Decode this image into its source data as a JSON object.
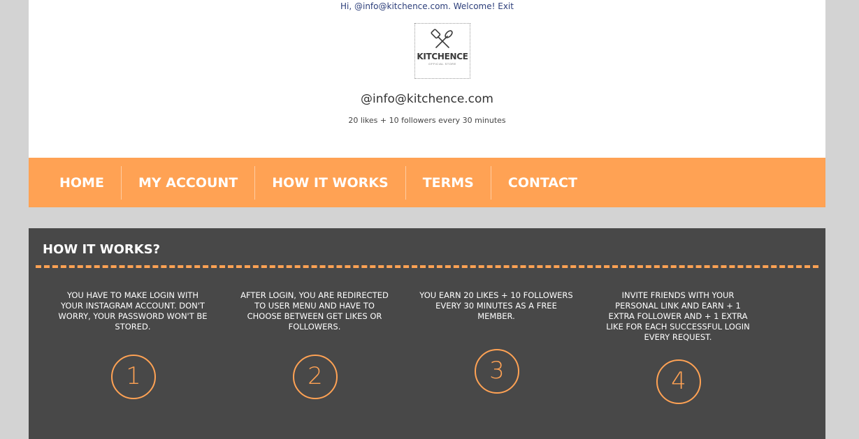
{
  "header": {
    "welcome_prefix": "Hi, @info@kitchence.com. Welcome! ",
    "exit_label": "Exit",
    "logo_text": "KITCHENCE",
    "logo_sub": "OFFICIAL STORE",
    "username": "@info@kitchence.com",
    "plan": "20 likes + 10 followers every 30 minutes"
  },
  "nav": {
    "items": [
      {
        "label": "HOME"
      },
      {
        "label": "MY ACCOUNT"
      },
      {
        "label": "HOW IT WORKS"
      },
      {
        "label": "TERMS"
      },
      {
        "label": "CONTACT"
      }
    ]
  },
  "how": {
    "title": "HOW IT WORKS?",
    "steps": [
      {
        "number": "1",
        "text": "You have to make login with your instagram account. Don't worry, your password won't be stored."
      },
      {
        "number": "2",
        "text": "After login, you are redirected to user menu and have to choose between get likes or followers."
      },
      {
        "number": "3",
        "text": "You earn 20 likes + 10 followers every 30 minutes as a free member."
      },
      {
        "number": "4",
        "text": "Invite friends with your personal link and earn + 1 extra follower and + 1 extra like for each successful login every request."
      }
    ]
  },
  "colors": {
    "accent": "#ffa254",
    "dark_panel": "#484848",
    "page_bg": "#d3d3d3",
    "link": "#2c3e7a"
  }
}
